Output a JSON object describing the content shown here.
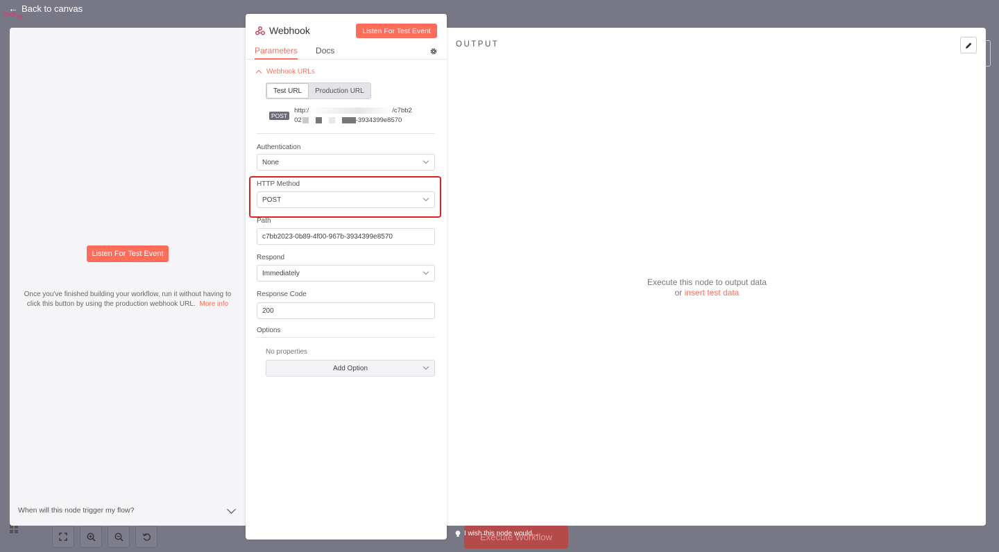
{
  "canvas": {
    "back_label": "Back to canvas",
    "execute_label": "Execute Workflow"
  },
  "input_panel": {
    "listen_label": "Listen For Test Event",
    "help_text": "Once you've finished building your workflow, run it without having to click this button by using the production webhook URL.",
    "more_info": "More info",
    "trigger_question": "When will this node trigger my flow?"
  },
  "node": {
    "title": "Webhook",
    "listen_label": "Listen For Test Event",
    "tabs": [
      {
        "label": "Parameters",
        "active": true
      },
      {
        "label": "Docs",
        "active": false
      }
    ],
    "webhook_urls_label": "Webhook URLs",
    "url_toggle": {
      "test": "Test URL",
      "production": "Production URL"
    },
    "url": {
      "method": "POST",
      "line1_start": "http:/",
      "line1_end": "/c7bb2",
      "line2_start": "02",
      "line2_end": "-3934399e8570"
    },
    "fields": {
      "authentication": {
        "label": "Authentication",
        "value": "None"
      },
      "http_method": {
        "label": "HTTP Method",
        "value": "POST"
      },
      "path": {
        "label": "Path",
        "value": "c7bb2023-0b89-4f00-967b-3934399e8570"
      },
      "respond": {
        "label": "Respond",
        "value": "Immediately"
      },
      "response_code": {
        "label": "Response Code",
        "value": "200"
      }
    },
    "options": {
      "label": "Options",
      "empty_text": "No properties",
      "add_label": "Add Option"
    }
  },
  "output_panel": {
    "title": "OUTPUT",
    "empty_line1": "Execute this node to output data",
    "empty_or": "or",
    "insert_link": "insert test data"
  },
  "footer": {
    "wish_label": "I wish this node would..."
  },
  "colors": {
    "accent": "#ff6d5a",
    "backdrop": "#777786",
    "highlight": "#e02020"
  }
}
